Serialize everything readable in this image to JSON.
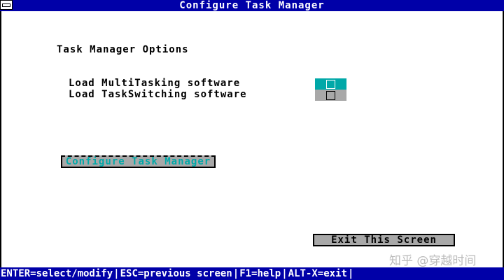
{
  "window": {
    "title": "Configure Task Manager"
  },
  "section": {
    "title": "Task Manager Options"
  },
  "options": [
    {
      "label": "Load MultiTasking software",
      "checked": false
    },
    {
      "label": "Load TaskSwitching software",
      "checked": false
    }
  ],
  "buttons": {
    "configure_label": "Configure Task Manager",
    "exit_label": "Exit This Screen"
  },
  "statusbar": {
    "items": [
      "ENTER=select/modify",
      "ESC=previous screen",
      "F1=help",
      "ALT-X=exit"
    ]
  },
  "watermark": "知乎 @穿越时间",
  "colors": {
    "title_bg": "#0000a8",
    "highlight": "#00a8a8",
    "button_bg": "#a8a8a8"
  },
  "icons": {
    "system_menu": "system-menu-icon",
    "checkbox": "checkbox-icon"
  }
}
